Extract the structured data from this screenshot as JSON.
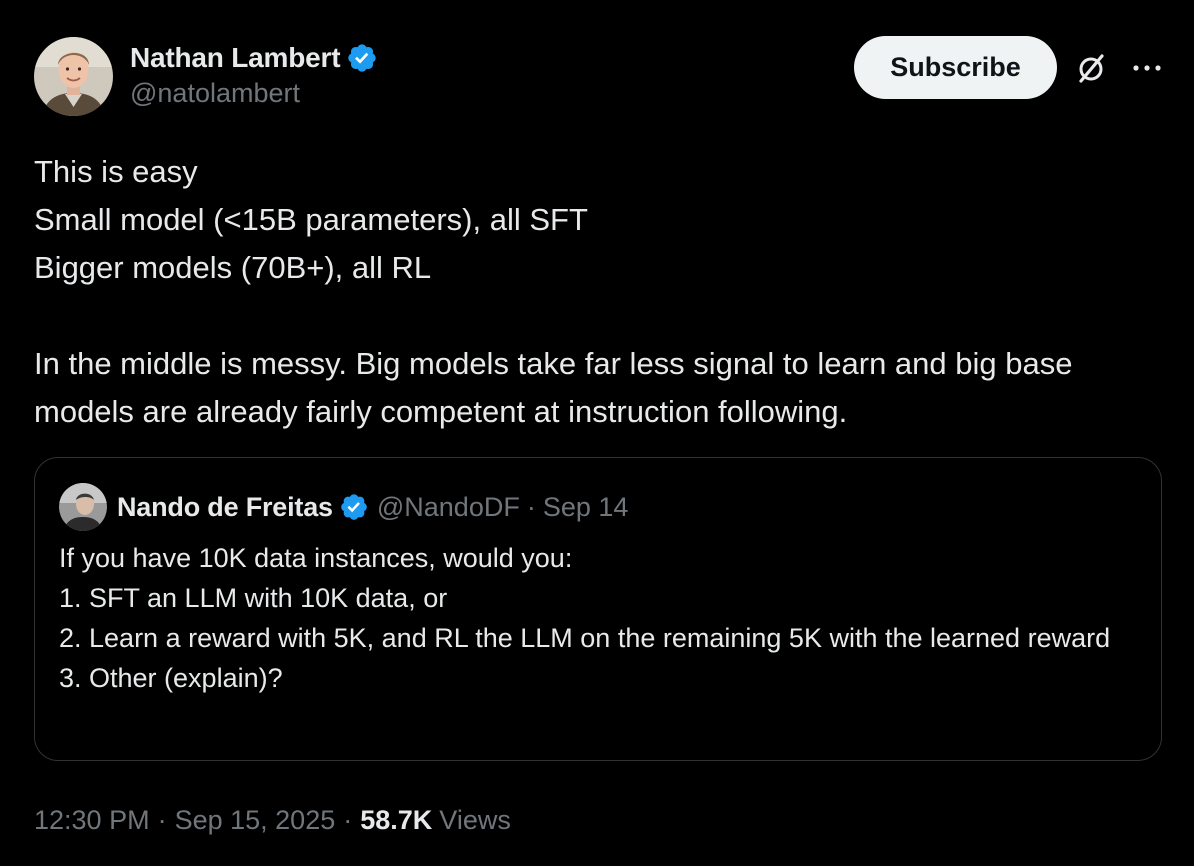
{
  "author": {
    "name": "Nathan Lambert",
    "handle": "@natolambert",
    "verified": true,
    "avatar_icon": "avatar-photo"
  },
  "actions": {
    "subscribe_label": "Subscribe",
    "grok_icon": "grok-icon",
    "more_icon": "more-icon"
  },
  "tweet": {
    "text": "This is easy\nSmall model (<15B parameters), all SFT\nBigger models (70B+), all RL\n\nIn the middle is messy. Big models take far less signal to learn and big base models are already fairly competent at instruction following."
  },
  "quoted_tweet": {
    "author_name": "Nando de Freitas",
    "verified": true,
    "handle": "@NandoDF",
    "separator": "·",
    "date": "Sep 14",
    "text": "If you have 10K data instances, would you:\n1. SFT an LLM with 10K data, or\n2. Learn a reward with 5K, and RL the LLM on the remaining 5K with the learned reward\n3. Other (explain)?"
  },
  "meta": {
    "time": "12:30 PM",
    "separator": "·",
    "date": "Sep 15, 2025",
    "views_count": "58.7K",
    "views_label": "Views"
  },
  "colors": {
    "background": "#000000",
    "text_primary": "#e7e9ea",
    "text_secondary": "#71767b",
    "verified_blue": "#1d9bf0",
    "subscribe_bg": "#eff3f4",
    "border": "#2f3336"
  }
}
